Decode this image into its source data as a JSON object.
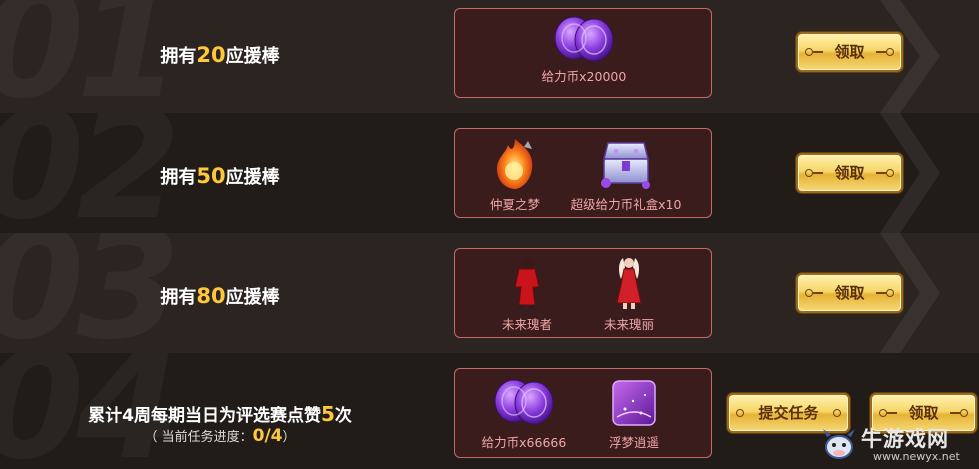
{
  "rows": [
    {
      "index": "01",
      "condition": {
        "prefix": "拥有",
        "value": "20",
        "suffix": "应援棒"
      },
      "rewards": [
        {
          "icon": "purple-coin-icon",
          "label": "给力币x20000"
        }
      ],
      "button": "领取"
    },
    {
      "index": "02",
      "condition": {
        "prefix": "拥有",
        "value": "50",
        "suffix": "应援棒"
      },
      "rewards": [
        {
          "icon": "flame-orb-icon",
          "label": "仲夏之梦"
        },
        {
          "icon": "treasure-chest-icon",
          "label": "超级给力币礼盒x10"
        }
      ],
      "button": "领取"
    },
    {
      "index": "03",
      "condition": {
        "prefix": "拥有",
        "value": "80",
        "suffix": "应援棒"
      },
      "rewards": [
        {
          "icon": "red-outfit-icon",
          "label": "未来瑰者"
        },
        {
          "icon": "red-dress-icon",
          "label": "未来瑰丽"
        }
      ],
      "button": "领取"
    },
    {
      "index": "04",
      "condition": {
        "prefix": "累计4周每期当日为评选赛点赞",
        "value": "5",
        "suffix": "次"
      },
      "progress": {
        "label": "（ 当前任务进度：",
        "value": "0/4",
        "close": "）"
      },
      "rewards": [
        {
          "icon": "purple-coin-icon",
          "label": "给力币x66666"
        },
        {
          "icon": "purple-card-icon",
          "label": "浮梦逍遥"
        }
      ],
      "submit_button": "提交任务",
      "button": "领取"
    }
  ],
  "watermark": {
    "text": "牛游戏网",
    "url": "www.newyx.net"
  },
  "colors": {
    "highlight": "#ffc83a",
    "box_border": "#c06a6a",
    "box_bg": "#3a1c1c",
    "reward_label": "#f1a6a6",
    "button_gold": "#f7d669"
  }
}
